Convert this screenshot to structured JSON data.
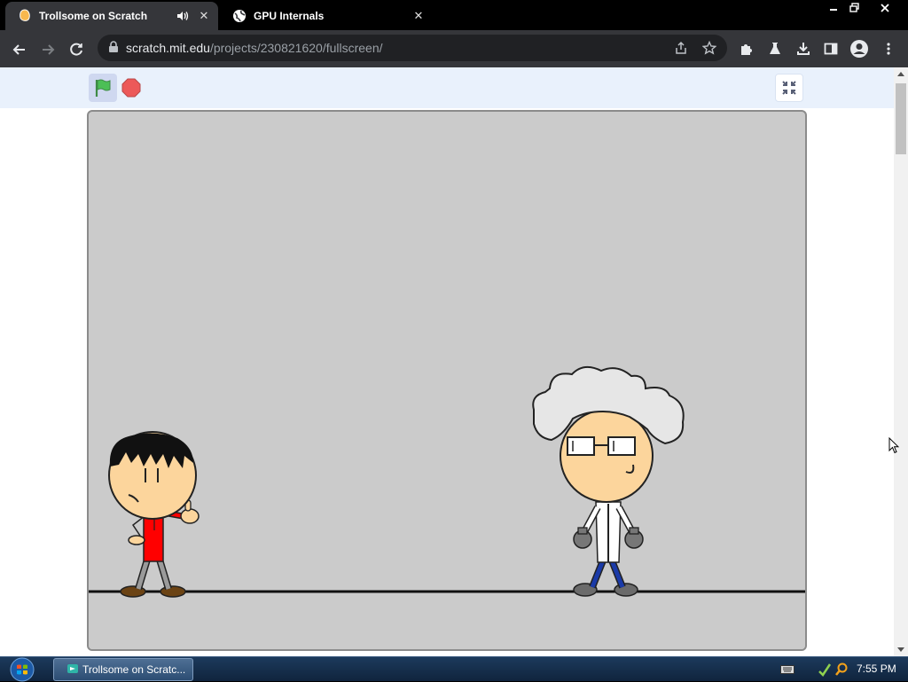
{
  "tabs": [
    {
      "title": "Trollsome on Scratch",
      "active": true,
      "audio": true
    },
    {
      "title": "GPU Internals",
      "active": false
    }
  ],
  "address_bar": {
    "host": "scratch.mit.edu",
    "path": "/projects/230821620/fullscreen/"
  },
  "icons": {
    "back": "back-arrow-icon",
    "forward": "forward-arrow-icon",
    "reload": "reload-icon",
    "lock": "lock-icon",
    "share": "share-icon",
    "bookmark": "star-icon",
    "extensions": "puzzle-icon",
    "labs": "flask-icon",
    "download": "download-icon",
    "sidepanel": "side-panel-icon",
    "profile": "profile-icon",
    "menu": "kebab-menu-icon"
  },
  "scratch": {
    "green_flag": "green-flag-icon",
    "stop": "stop-icon",
    "exit_fullscreen": "exit-fullscreen-icon"
  },
  "taskbar": {
    "task_label": "Trollsome on Scratc...",
    "time": "7:55 PM"
  },
  "colors": {
    "stage_bg": "#cbcbcb",
    "header_bg": "#e9f1fc",
    "flag_green": "#4cbf56",
    "stop_red": "#ec5959"
  }
}
